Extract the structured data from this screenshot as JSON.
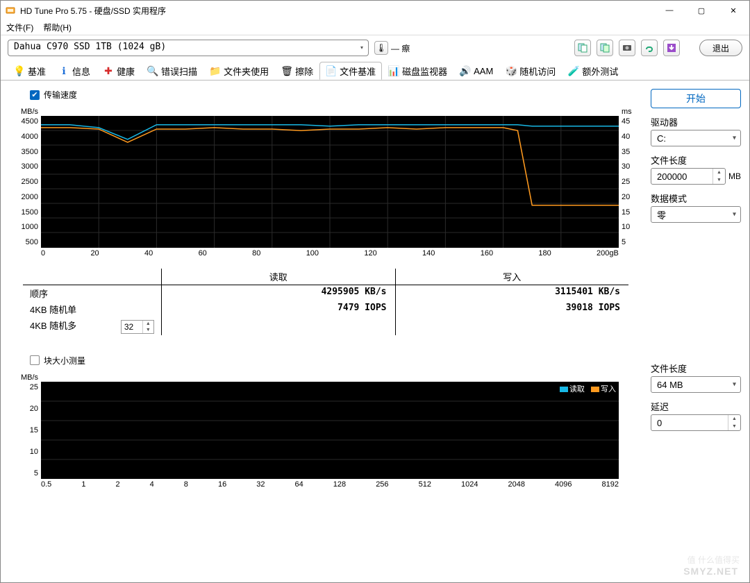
{
  "window": {
    "title": "HD Tune Pro 5.75 - 硬盘/SSD 实用程序",
    "controls": {
      "min": "—",
      "max": "▢",
      "close": "✕"
    }
  },
  "menu": {
    "file": "文件(F)",
    "help": "帮助(H)"
  },
  "toolbar": {
    "device": "Dahua C970 SSD 1TB (1024 gB)",
    "temp_dashes": "— 瘵",
    "exit": "退出"
  },
  "tabs": [
    {
      "label": "基准"
    },
    {
      "label": "信息"
    },
    {
      "label": "健康"
    },
    {
      "label": "错误扫描"
    },
    {
      "label": "文件夹使用"
    },
    {
      "label": "擦除"
    },
    {
      "label": "文件基准"
    },
    {
      "label": "磁盘监视器"
    },
    {
      "label": "AAM"
    },
    {
      "label": "随机访问"
    },
    {
      "label": "额外测试"
    }
  ],
  "active_tab": 6,
  "transfer_checkbox": "传输速度",
  "block_checkbox": "块大小测量",
  "chart1": {
    "y_left_unit": "MB/s",
    "y_right_unit": "ms",
    "y_left_ticks": [
      "4500",
      "4000",
      "3500",
      "3000",
      "2500",
      "2000",
      "1500",
      "1000",
      "500"
    ],
    "y_right_ticks": [
      "45",
      "40",
      "35",
      "30",
      "25",
      "20",
      "15",
      "10",
      "5"
    ],
    "x_ticks": [
      "0",
      "20",
      "40",
      "60",
      "80",
      "100",
      "120",
      "140",
      "160",
      "180",
      "200gB"
    ]
  },
  "results": {
    "hdr_blank": "",
    "hdr_read": "读取",
    "hdr_write": "写入",
    "seq_label": "顺序",
    "seq_read": "4295905 KB/s",
    "seq_write": "3115401 KB/s",
    "rnd1_label": "4KB 随机单",
    "rnd1_read": "7479 IOPS",
    "rnd1_write": "39018 IOPS",
    "rndN_label": "4KB 随机多",
    "rndN_qd": "32"
  },
  "chart2": {
    "y_left_unit": "MB/s",
    "y_left_ticks": [
      "25",
      "20",
      "15",
      "10",
      "5"
    ],
    "x_ticks": [
      "0.5",
      "1",
      "2",
      "4",
      "8",
      "16",
      "32",
      "64",
      "128",
      "256",
      "512",
      "1024",
      "2048",
      "4096",
      "8192"
    ],
    "legend_read": "读取",
    "legend_write": "写入"
  },
  "right": {
    "start": "开始",
    "drive_label": "驱动器",
    "drive_value": "C:",
    "filelen_label": "文件长度",
    "filelen_value": "200000",
    "filelen_unit": "MB",
    "pattern_label": "数据模式",
    "pattern_value": "零",
    "filelen2_label": "文件长度",
    "filelen2_value": "64 MB",
    "delay_label": "延迟",
    "delay_value": "0"
  },
  "chart_data": [
    {
      "type": "line",
      "title": "传输速度",
      "xlabel": "gB",
      "ylabel_left": "MB/s",
      "ylabel_right": "ms",
      "xlim": [
        0,
        200
      ],
      "ylim_left": [
        0,
        4500
      ],
      "ylim_right": [
        0,
        45
      ],
      "x": [
        0,
        10,
        20,
        30,
        40,
        50,
        60,
        70,
        80,
        90,
        100,
        110,
        120,
        130,
        140,
        150,
        160,
        165,
        170,
        180,
        190,
        200
      ],
      "series": [
        {
          "name": "读取",
          "axis": "left",
          "color": "#18b8e6",
          "values": [
            4200,
            4200,
            4100,
            3700,
            4200,
            4200,
            4200,
            4200,
            4200,
            4200,
            4150,
            4200,
            4200,
            4200,
            4200,
            4200,
            4200,
            4200,
            4150,
            4150,
            4150,
            4150
          ]
        },
        {
          "name": "写入",
          "axis": "left",
          "color": "#ff9a1f",
          "values": [
            4100,
            4100,
            4050,
            3600,
            4050,
            4050,
            4100,
            4050,
            4050,
            4000,
            4050,
            4050,
            4100,
            4050,
            4100,
            4100,
            4100,
            4000,
            1450,
            1450,
            1450,
            1450
          ]
        }
      ]
    },
    {
      "type": "bar",
      "title": "块大小测量",
      "xlabel": "KB",
      "ylabel": "MB/s",
      "xlim_log2": [
        -1,
        13
      ],
      "ylim": [
        0,
        25
      ],
      "categories": [
        "0.5",
        "1",
        "2",
        "4",
        "8",
        "16",
        "32",
        "64",
        "128",
        "256",
        "512",
        "1024",
        "2048",
        "4096",
        "8192"
      ],
      "series": [
        {
          "name": "读取",
          "color": "#18b8e6",
          "values": []
        },
        {
          "name": "写入",
          "color": "#ff9a1f",
          "values": []
        }
      ]
    }
  ],
  "watermark": "SMYZ.NET"
}
